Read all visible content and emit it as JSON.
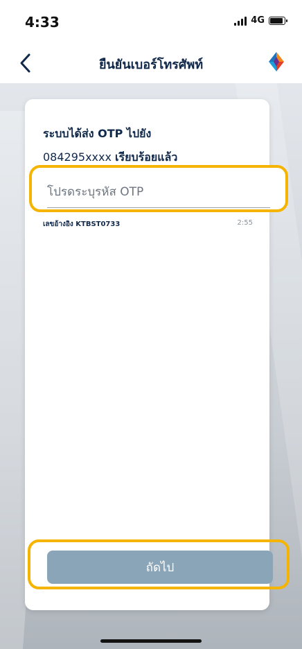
{
  "status_bar": {
    "time": "4:33",
    "network": "4G"
  },
  "nav": {
    "title": "ยืนยันเบอร์โทรศัพท์",
    "back_icon": "chevron-left-icon",
    "logo_icon": "bank-logo-icon"
  },
  "message": {
    "line1": "ระบบได้ส่ง OTP ไปยัง",
    "phone_number": "084295xxxx",
    "sent_done": "เรียบร้อยแล้ว"
  },
  "otp": {
    "placeholder": "โปรดระบุรหัส OTP",
    "value": "",
    "reference": "เลขอ้างอิง KTBST0733",
    "timer": "2:55"
  },
  "next_button": {
    "label": "ถัดไป"
  },
  "colors": {
    "primary_text": "#10284a",
    "highlight": "#f5b400",
    "button_disabled": "#8ba5b8"
  }
}
